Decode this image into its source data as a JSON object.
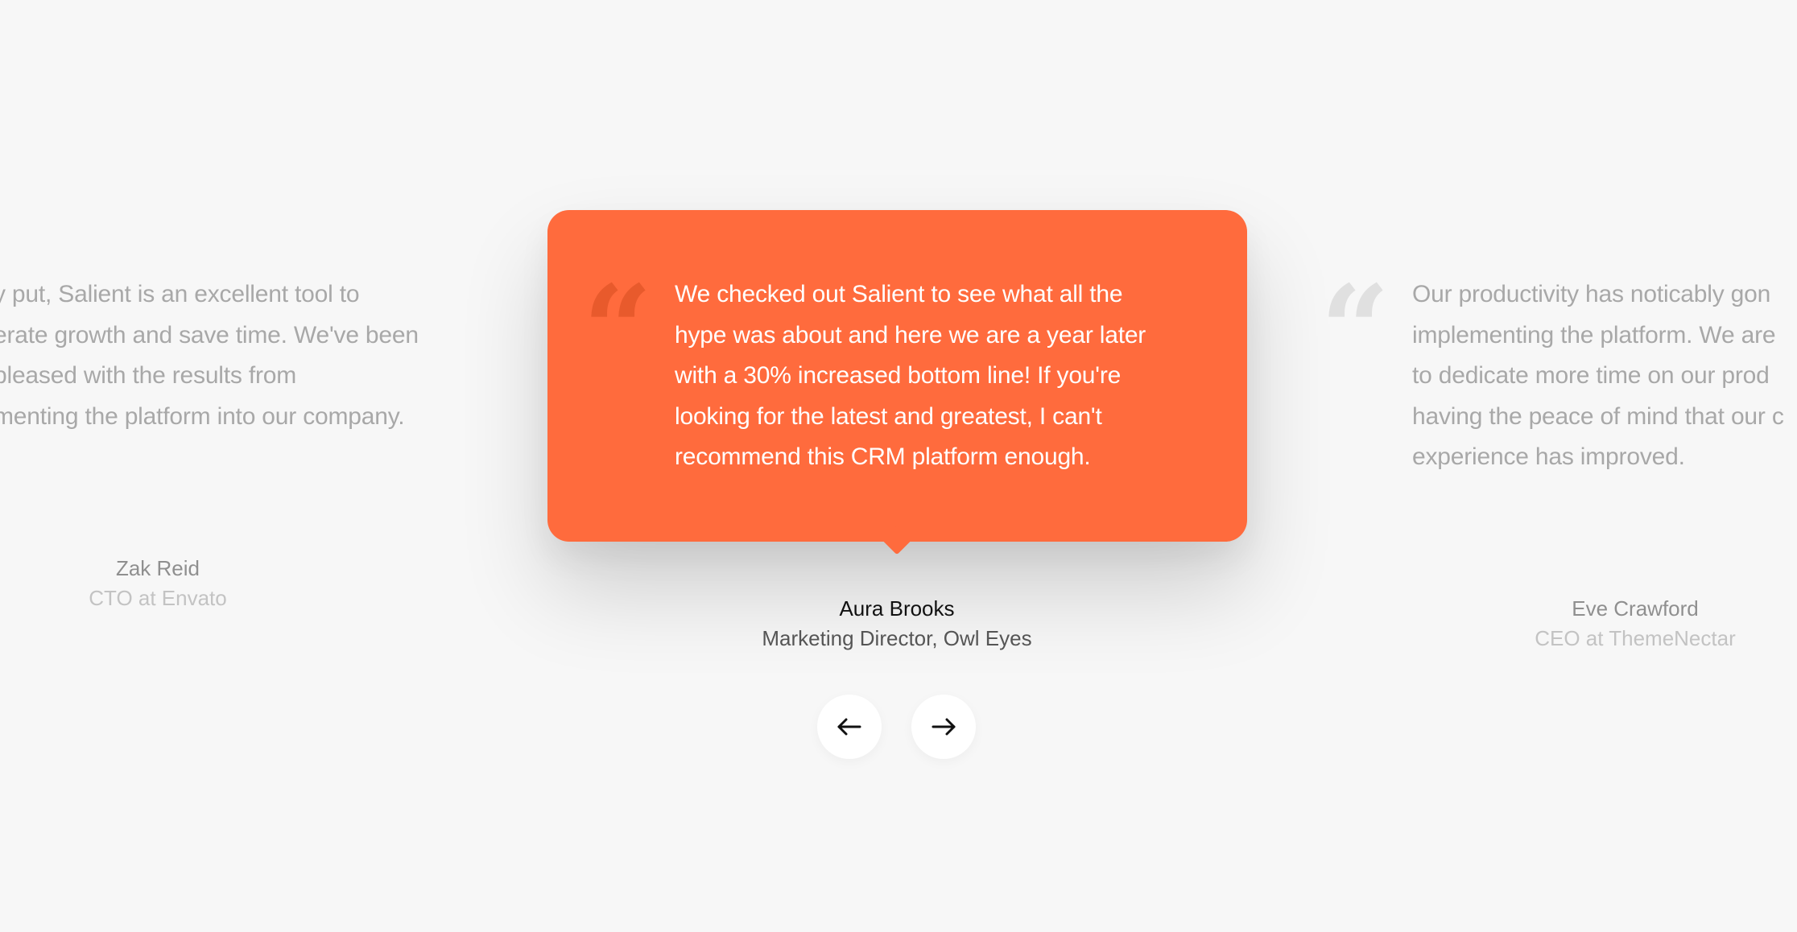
{
  "testimonials": {
    "left": {
      "quote_lines": [
        "y put, Salient is an excellent tool to",
        "erate growth and save time. We've been",
        "pleased with the results from",
        "menting the platform into our company."
      ],
      "name": "Zak Reid",
      "title": "CTO at Envato"
    },
    "active": {
      "quote_mark": "“",
      "quote_lines": [
        "We checked out Salient to see what all the",
        "hype was about and here we are a year later",
        "with a 30% increased bottom line! If you're",
        "looking for the latest and greatest, I can't",
        "recommend this CRM platform enough."
      ],
      "name": "Aura Brooks",
      "title": "Marketing Director, Owl Eyes",
      "background_color": "#ff6b3d"
    },
    "right": {
      "quote_mark": "“",
      "quote_lines": [
        "Our productivity has noticably gon",
        "implementing the platform. We are",
        "to dedicate more time on our prod",
        "having the peace of mind that our c",
        "experience has improved."
      ],
      "name": "Eve Crawford",
      "title": "CEO at ThemeNectar"
    }
  },
  "navigation": {
    "prev_icon": "arrow-left-icon",
    "next_icon": "arrow-right-icon"
  }
}
